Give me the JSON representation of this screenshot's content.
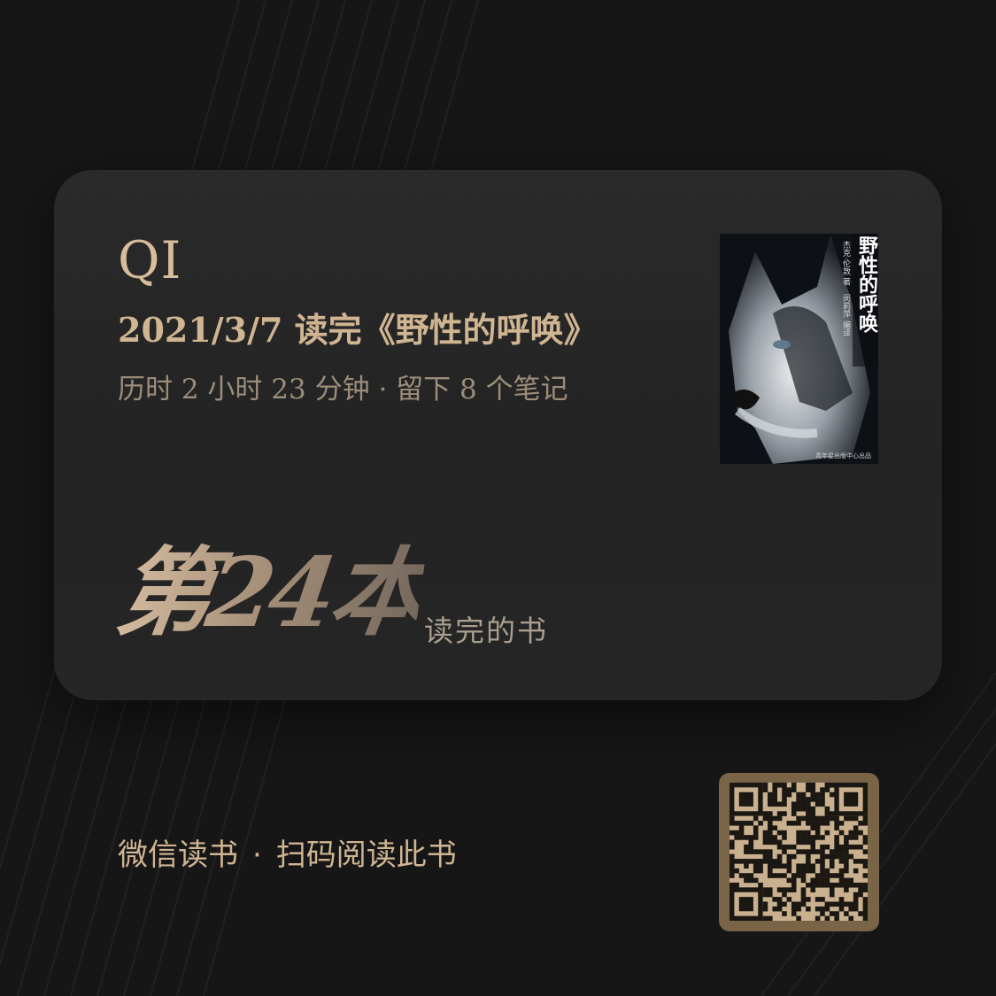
{
  "user": {
    "name": "QI"
  },
  "reading": {
    "finish_line": "2021/3/7 读完《野性的呼唤》",
    "stats_line": "历时 2 小时 23 分钟 · 留下 8 个笔记"
  },
  "book_cover": {
    "title": "野性的呼唤",
    "author_line": "杰克·伦敦 著",
    "translator_line": "闵莉萍 编译",
    "publisher_line": "青年星出版中心出品"
  },
  "rank": {
    "number_text": "第24本",
    "suffix": "读完的书"
  },
  "footer": {
    "app_name": "微信读书",
    "separator": "·",
    "cta": "扫码阅读此书"
  },
  "colors": {
    "accent_gold": "#d8bd9c",
    "card_bg": "#262626",
    "page_bg": "#161616"
  }
}
